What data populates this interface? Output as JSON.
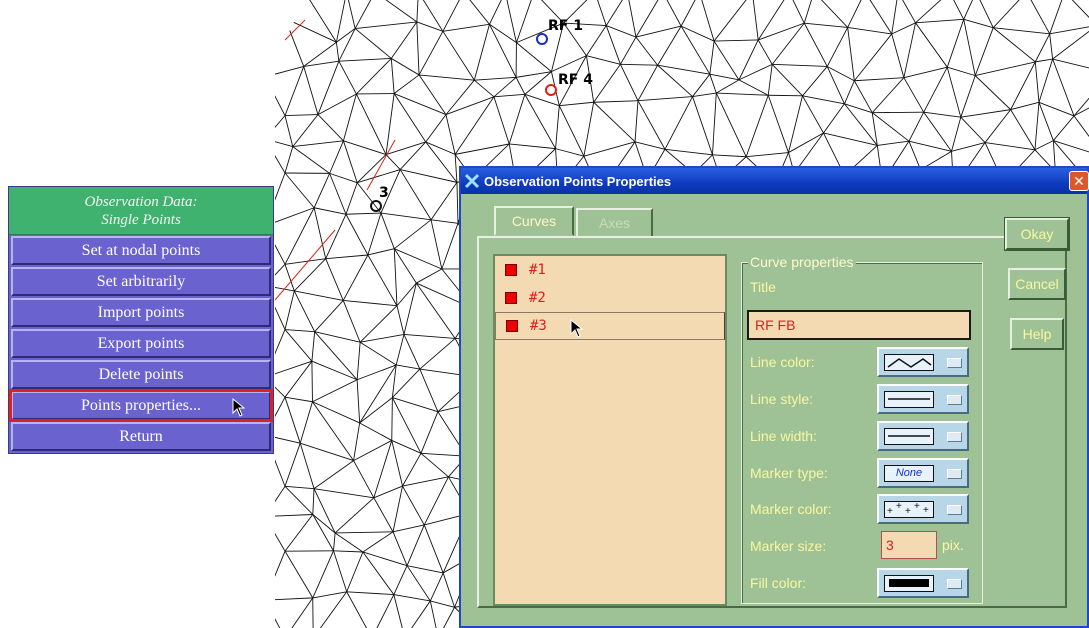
{
  "menu": {
    "header_line1": "Observation Data:",
    "header_line2": "Single Points",
    "items": [
      {
        "label": "Set at nodal points"
      },
      {
        "label": "Set arbitrarily"
      },
      {
        "label": "Import points"
      },
      {
        "label": "Export points"
      },
      {
        "label": "Delete points"
      },
      {
        "label": "Points properties..."
      },
      {
        "label": "Return"
      }
    ]
  },
  "canvas": {
    "labels": [
      "RF 1",
      "RF 4",
      "3"
    ]
  },
  "dialog": {
    "title": "Observation Points Properties",
    "close_glyph": "✕",
    "tabs": [
      {
        "label": "Curves"
      },
      {
        "label": "Axes"
      }
    ],
    "curves": [
      {
        "label": "#1"
      },
      {
        "label": "#2"
      },
      {
        "label": "#3"
      }
    ],
    "props": {
      "legend": "Curve properties",
      "title_label": "Title",
      "title_value": "RF FB",
      "line_color_label": "Line color:",
      "line_style_label": "Line style:",
      "line_width_label": "Line width:",
      "marker_type_label": "Marker type:",
      "marker_type_value": "None",
      "marker_color_label": "Marker color:",
      "marker_size_label": "Marker size:",
      "marker_size_value": "3",
      "marker_size_unit": "pix.",
      "fill_color_label": "Fill color:"
    },
    "buttons": {
      "okay": "Okay",
      "cancel": "Cancel",
      "help": "Help"
    }
  },
  "colors": {
    "menu_bg": "#6a62cf",
    "menu_header": "#3fb26f",
    "dialog_bg": "#9ec296",
    "list_bg": "#f3dab2",
    "accent_red": "#e11d1d"
  }
}
